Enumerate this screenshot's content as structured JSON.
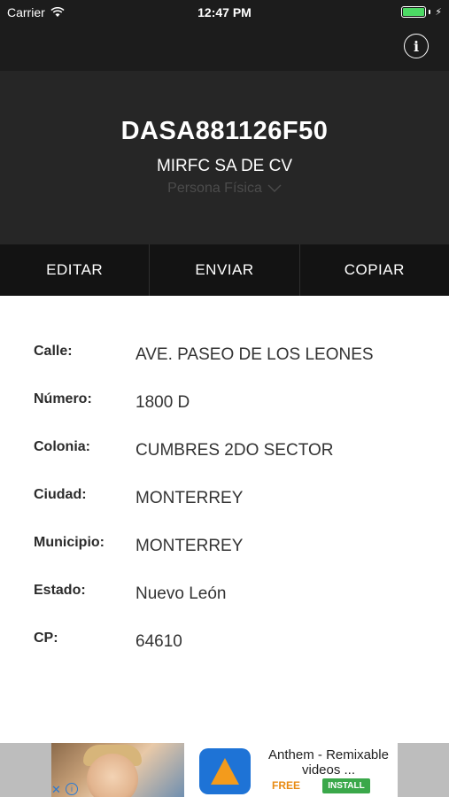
{
  "status_bar": {
    "carrier": "Carrier",
    "time": "12:47 PM",
    "battery_level": 1.0,
    "battery_color": "#4cd964"
  },
  "nav": {
    "info_icon": "info-icon",
    "info_glyph": "i"
  },
  "header": {
    "rfc": "DASA881126F50",
    "company": "MIRFC SA DE CV",
    "persona_type": "Persona Física"
  },
  "actions": [
    {
      "label": "EDITAR"
    },
    {
      "label": "ENVIAR"
    },
    {
      "label": "COPIAR"
    }
  ],
  "details": [
    {
      "label": "Calle:",
      "value": "AVE. PASEO DE LOS LEONES"
    },
    {
      "label": "Número:",
      "value": "1800 D"
    },
    {
      "label": "Colonia:",
      "value": "CUMBRES 2DO SECTOR"
    },
    {
      "label": "Ciudad:",
      "value": "MONTERREY"
    },
    {
      "label": "Municipio:",
      "value": "MONTERREY"
    },
    {
      "label": "Estado:",
      "value": "Nuevo León"
    },
    {
      "label": "CP:",
      "value": "64610"
    }
  ],
  "ad": {
    "title": "Anthem - Remixable videos ...",
    "price": "FREE",
    "install_label": "INSTALL",
    "close_glyph": "✕",
    "info_glyph": "i"
  }
}
